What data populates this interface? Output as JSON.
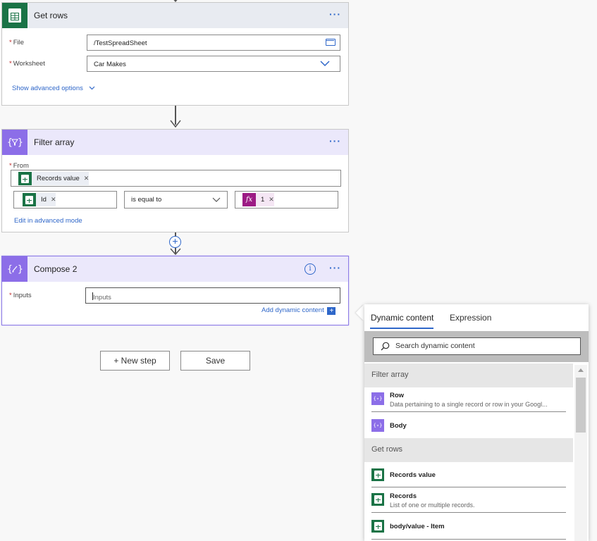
{
  "get_rows": {
    "title": "Get rows",
    "more": "···",
    "file_label": "File",
    "file_value": "/TestSpreadSheet",
    "worksheet_label": "Worksheet",
    "worksheet_value": "Car Makes",
    "advanced_link": "Show advanced options"
  },
  "filter_array": {
    "title": "Filter array",
    "more": "···",
    "from_label": "From",
    "from_token": "Records value",
    "left_token": "Id",
    "operator": "is equal to",
    "right_token": "1",
    "fx_label": "fx",
    "advanced_link": "Edit in advanced mode"
  },
  "compose": {
    "title": "Compose 2",
    "more": "···",
    "info": "i",
    "inputs_label": "Inputs",
    "inputs_placeholder": "Inputs",
    "add_dynamic": "Add dynamic content",
    "add_icon": "+"
  },
  "buttons": {
    "new_step": "+ New step",
    "save": "Save"
  },
  "panel": {
    "tabs": [
      "Dynamic content",
      "Expression"
    ],
    "search_placeholder": "Search dynamic content",
    "sections": [
      {
        "title": "Filter array",
        "items": [
          {
            "title": "Row",
            "desc": "Data pertaining to a single record or row in your Googl..."
          },
          {
            "title": "Body",
            "desc": ""
          }
        ]
      },
      {
        "title": "Get rows",
        "items": [
          {
            "title": "Records value",
            "desc": ""
          },
          {
            "title": "Records",
            "desc": "List of one or multiple records."
          },
          {
            "title": "body/value - Item",
            "desc": ""
          }
        ]
      }
    ]
  },
  "colors": {
    "accent": "#2f67c9",
    "sheets_green": "#1a7346",
    "action_purple": "#8c6ee8",
    "expression_magenta": "#9c1b84",
    "required_red": "#c02b2b"
  },
  "icons": {
    "get_rows": "google-sheets-icon",
    "filter_array": "filter-array-icon",
    "compose": "compose-icon",
    "file_picker": "folder-icon",
    "dropdown": "chevron-down-icon",
    "search": "search-icon"
  }
}
